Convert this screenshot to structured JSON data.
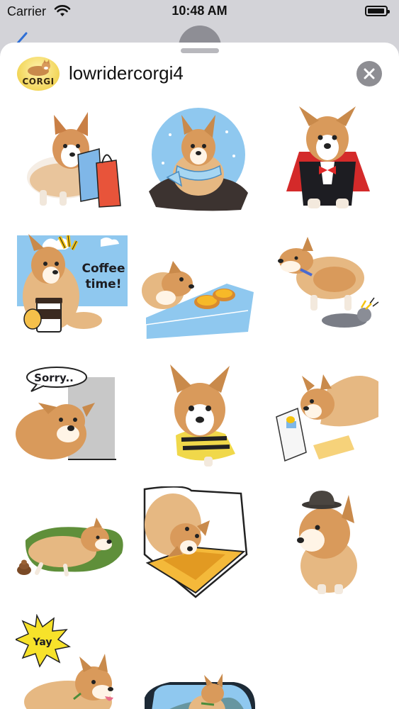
{
  "status_bar": {
    "carrier": "Carrier",
    "time": "10:48 AM"
  },
  "sticker_pack": {
    "icon_label": "CORGI",
    "title": "lowridercorgi4"
  },
  "stickers": [
    {
      "id": "shopping-bags",
      "caption": ""
    },
    {
      "id": "scarf-snow",
      "caption": ""
    },
    {
      "id": "dracula-costume",
      "caption": ""
    },
    {
      "id": "coffee-time",
      "caption": "Coffee time!"
    },
    {
      "id": "egg-tart",
      "caption": ""
    },
    {
      "id": "with-cat",
      "caption": ""
    },
    {
      "id": "sorry",
      "caption": "Sorry.."
    },
    {
      "id": "bee-costume",
      "caption": ""
    },
    {
      "id": "reading",
      "caption": ""
    },
    {
      "id": "on-grass",
      "caption": ""
    },
    {
      "id": "on-cushion",
      "caption": ""
    },
    {
      "id": "bowler-hat",
      "caption": ""
    },
    {
      "id": "yay",
      "caption": "Yay"
    },
    {
      "id": "car-window",
      "caption": ""
    }
  ],
  "colors": {
    "sky_blue": "#8fc8ef",
    "corgi_tan": "#d99a5b",
    "close_gray": "#8e8e93"
  }
}
